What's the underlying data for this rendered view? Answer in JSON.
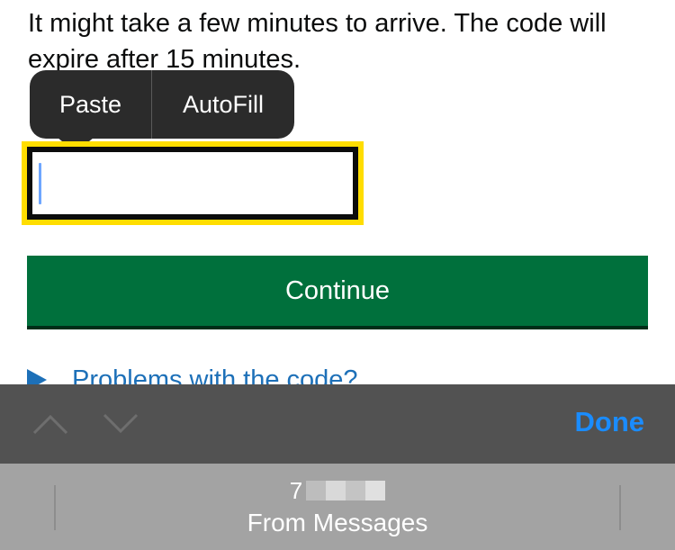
{
  "instructions": {
    "text": "It might take a few minutes to arrive. The code will expire after 15 minutes."
  },
  "callout": {
    "paste_label": "Paste",
    "autofill_label": "AutoFill"
  },
  "code_field": {
    "value": "",
    "placeholder": ""
  },
  "continue_label": "Continue",
  "details": {
    "summary": "Problems with the code?"
  },
  "keyboard_accessory": {
    "done_label": "Done"
  },
  "autofill_suggestion": {
    "code_visible_digit": "7",
    "source_label": "From Messages"
  },
  "colors": {
    "primary_button": "#00703c",
    "focus_ring": "#ffdd00",
    "link": "#1d70b8",
    "done_blue": "#1a8cff",
    "callout_bg": "#2b2b2b"
  }
}
